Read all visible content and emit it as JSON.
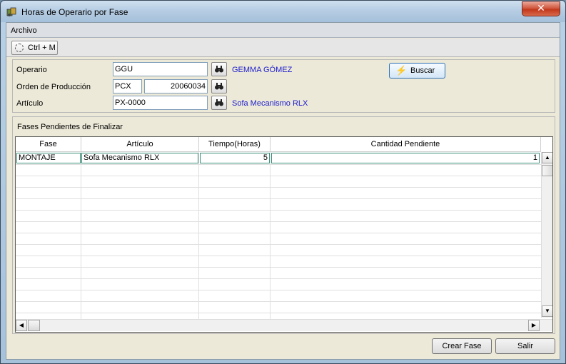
{
  "window": {
    "title": "Horas de Operario por Fase",
    "close_label": "✕"
  },
  "menu": {
    "archivo": "Archivo"
  },
  "toolbar": {
    "shortcut_label": "Ctrl + M"
  },
  "filters": {
    "operario_label": "Operario",
    "operario_value": "GGU",
    "operario_name": "GEMMA GÓMEZ",
    "orden_label": "Orden de Producción",
    "orden_serie": "PCX",
    "orden_numero": "20060034",
    "articulo_label": "Artículo",
    "articulo_value": "PX-0000",
    "articulo_name": "Sofa Mecanismo RLX",
    "buscar_label": "Buscar"
  },
  "pending": {
    "title": "Fases Pendientes de Finalizar",
    "columns": [
      "Fase",
      "Artículo",
      "Tiempo(Horas)",
      "Cantidad Pendiente"
    ],
    "rows": [
      {
        "fase": "MONTAJE",
        "articulo": "Sofa Mecanismo RLX",
        "tiempo": "5",
        "cantidad": "1"
      }
    ]
  },
  "footer": {
    "crear_label": "Crear Fase",
    "salir_label": "Salir"
  },
  "colors": {
    "link": "#1c1ccc",
    "close": "#c2381c",
    "cell_border": "#3c8f7a"
  },
  "icons": {
    "app": "app-icon",
    "find": "binoculars-icon",
    "buscar": "lightning-icon",
    "shortcut": "clock-icon"
  }
}
